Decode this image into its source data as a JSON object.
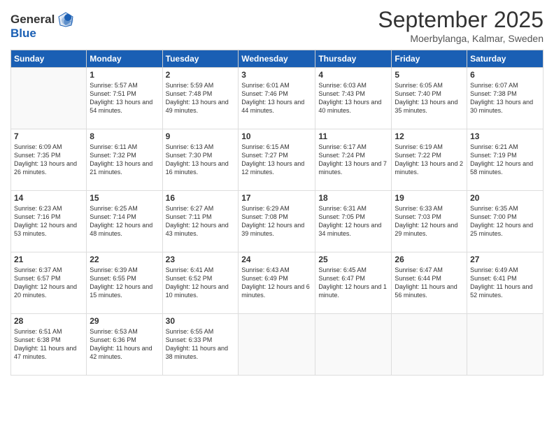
{
  "logo": {
    "general": "General",
    "blue": "Blue"
  },
  "header": {
    "month": "September 2025",
    "location": "Moerbylanga, Kalmar, Sweden"
  },
  "weekdays": [
    "Sunday",
    "Monday",
    "Tuesday",
    "Wednesday",
    "Thursday",
    "Friday",
    "Saturday"
  ],
  "weeks": [
    [
      {
        "day": "",
        "sunrise": "",
        "sunset": "",
        "daylight": ""
      },
      {
        "day": "1",
        "sunrise": "Sunrise: 5:57 AM",
        "sunset": "Sunset: 7:51 PM",
        "daylight": "Daylight: 13 hours and 54 minutes."
      },
      {
        "day": "2",
        "sunrise": "Sunrise: 5:59 AM",
        "sunset": "Sunset: 7:48 PM",
        "daylight": "Daylight: 13 hours and 49 minutes."
      },
      {
        "day": "3",
        "sunrise": "Sunrise: 6:01 AM",
        "sunset": "Sunset: 7:46 PM",
        "daylight": "Daylight: 13 hours and 44 minutes."
      },
      {
        "day": "4",
        "sunrise": "Sunrise: 6:03 AM",
        "sunset": "Sunset: 7:43 PM",
        "daylight": "Daylight: 13 hours and 40 minutes."
      },
      {
        "day": "5",
        "sunrise": "Sunrise: 6:05 AM",
        "sunset": "Sunset: 7:40 PM",
        "daylight": "Daylight: 13 hours and 35 minutes."
      },
      {
        "day": "6",
        "sunrise": "Sunrise: 6:07 AM",
        "sunset": "Sunset: 7:38 PM",
        "daylight": "Daylight: 13 hours and 30 minutes."
      }
    ],
    [
      {
        "day": "7",
        "sunrise": "Sunrise: 6:09 AM",
        "sunset": "Sunset: 7:35 PM",
        "daylight": "Daylight: 13 hours and 26 minutes."
      },
      {
        "day": "8",
        "sunrise": "Sunrise: 6:11 AM",
        "sunset": "Sunset: 7:32 PM",
        "daylight": "Daylight: 13 hours and 21 minutes."
      },
      {
        "day": "9",
        "sunrise": "Sunrise: 6:13 AM",
        "sunset": "Sunset: 7:30 PM",
        "daylight": "Daylight: 13 hours and 16 minutes."
      },
      {
        "day": "10",
        "sunrise": "Sunrise: 6:15 AM",
        "sunset": "Sunset: 7:27 PM",
        "daylight": "Daylight: 13 hours and 12 minutes."
      },
      {
        "day": "11",
        "sunrise": "Sunrise: 6:17 AM",
        "sunset": "Sunset: 7:24 PM",
        "daylight": "Daylight: 13 hours and 7 minutes."
      },
      {
        "day": "12",
        "sunrise": "Sunrise: 6:19 AM",
        "sunset": "Sunset: 7:22 PM",
        "daylight": "Daylight: 13 hours and 2 minutes."
      },
      {
        "day": "13",
        "sunrise": "Sunrise: 6:21 AM",
        "sunset": "Sunset: 7:19 PM",
        "daylight": "Daylight: 12 hours and 58 minutes."
      }
    ],
    [
      {
        "day": "14",
        "sunrise": "Sunrise: 6:23 AM",
        "sunset": "Sunset: 7:16 PM",
        "daylight": "Daylight: 12 hours and 53 minutes."
      },
      {
        "day": "15",
        "sunrise": "Sunrise: 6:25 AM",
        "sunset": "Sunset: 7:14 PM",
        "daylight": "Daylight: 12 hours and 48 minutes."
      },
      {
        "day": "16",
        "sunrise": "Sunrise: 6:27 AM",
        "sunset": "Sunset: 7:11 PM",
        "daylight": "Daylight: 12 hours and 43 minutes."
      },
      {
        "day": "17",
        "sunrise": "Sunrise: 6:29 AM",
        "sunset": "Sunset: 7:08 PM",
        "daylight": "Daylight: 12 hours and 39 minutes."
      },
      {
        "day": "18",
        "sunrise": "Sunrise: 6:31 AM",
        "sunset": "Sunset: 7:05 PM",
        "daylight": "Daylight: 12 hours and 34 minutes."
      },
      {
        "day": "19",
        "sunrise": "Sunrise: 6:33 AM",
        "sunset": "Sunset: 7:03 PM",
        "daylight": "Daylight: 12 hours and 29 minutes."
      },
      {
        "day": "20",
        "sunrise": "Sunrise: 6:35 AM",
        "sunset": "Sunset: 7:00 PM",
        "daylight": "Daylight: 12 hours and 25 minutes."
      }
    ],
    [
      {
        "day": "21",
        "sunrise": "Sunrise: 6:37 AM",
        "sunset": "Sunset: 6:57 PM",
        "daylight": "Daylight: 12 hours and 20 minutes."
      },
      {
        "day": "22",
        "sunrise": "Sunrise: 6:39 AM",
        "sunset": "Sunset: 6:55 PM",
        "daylight": "Daylight: 12 hours and 15 minutes."
      },
      {
        "day": "23",
        "sunrise": "Sunrise: 6:41 AM",
        "sunset": "Sunset: 6:52 PM",
        "daylight": "Daylight: 12 hours and 10 minutes."
      },
      {
        "day": "24",
        "sunrise": "Sunrise: 6:43 AM",
        "sunset": "Sunset: 6:49 PM",
        "daylight": "Daylight: 12 hours and 6 minutes."
      },
      {
        "day": "25",
        "sunrise": "Sunrise: 6:45 AM",
        "sunset": "Sunset: 6:47 PM",
        "daylight": "Daylight: 12 hours and 1 minute."
      },
      {
        "day": "26",
        "sunrise": "Sunrise: 6:47 AM",
        "sunset": "Sunset: 6:44 PM",
        "daylight": "Daylight: 11 hours and 56 minutes."
      },
      {
        "day": "27",
        "sunrise": "Sunrise: 6:49 AM",
        "sunset": "Sunset: 6:41 PM",
        "daylight": "Daylight: 11 hours and 52 minutes."
      }
    ],
    [
      {
        "day": "28",
        "sunrise": "Sunrise: 6:51 AM",
        "sunset": "Sunset: 6:38 PM",
        "daylight": "Daylight: 11 hours and 47 minutes."
      },
      {
        "day": "29",
        "sunrise": "Sunrise: 6:53 AM",
        "sunset": "Sunset: 6:36 PM",
        "daylight": "Daylight: 11 hours and 42 minutes."
      },
      {
        "day": "30",
        "sunrise": "Sunrise: 6:55 AM",
        "sunset": "Sunset: 6:33 PM",
        "daylight": "Daylight: 11 hours and 38 minutes."
      },
      {
        "day": "",
        "sunrise": "",
        "sunset": "",
        "daylight": ""
      },
      {
        "day": "",
        "sunrise": "",
        "sunset": "",
        "daylight": ""
      },
      {
        "day": "",
        "sunrise": "",
        "sunset": "",
        "daylight": ""
      },
      {
        "day": "",
        "sunrise": "",
        "sunset": "",
        "daylight": ""
      }
    ]
  ]
}
